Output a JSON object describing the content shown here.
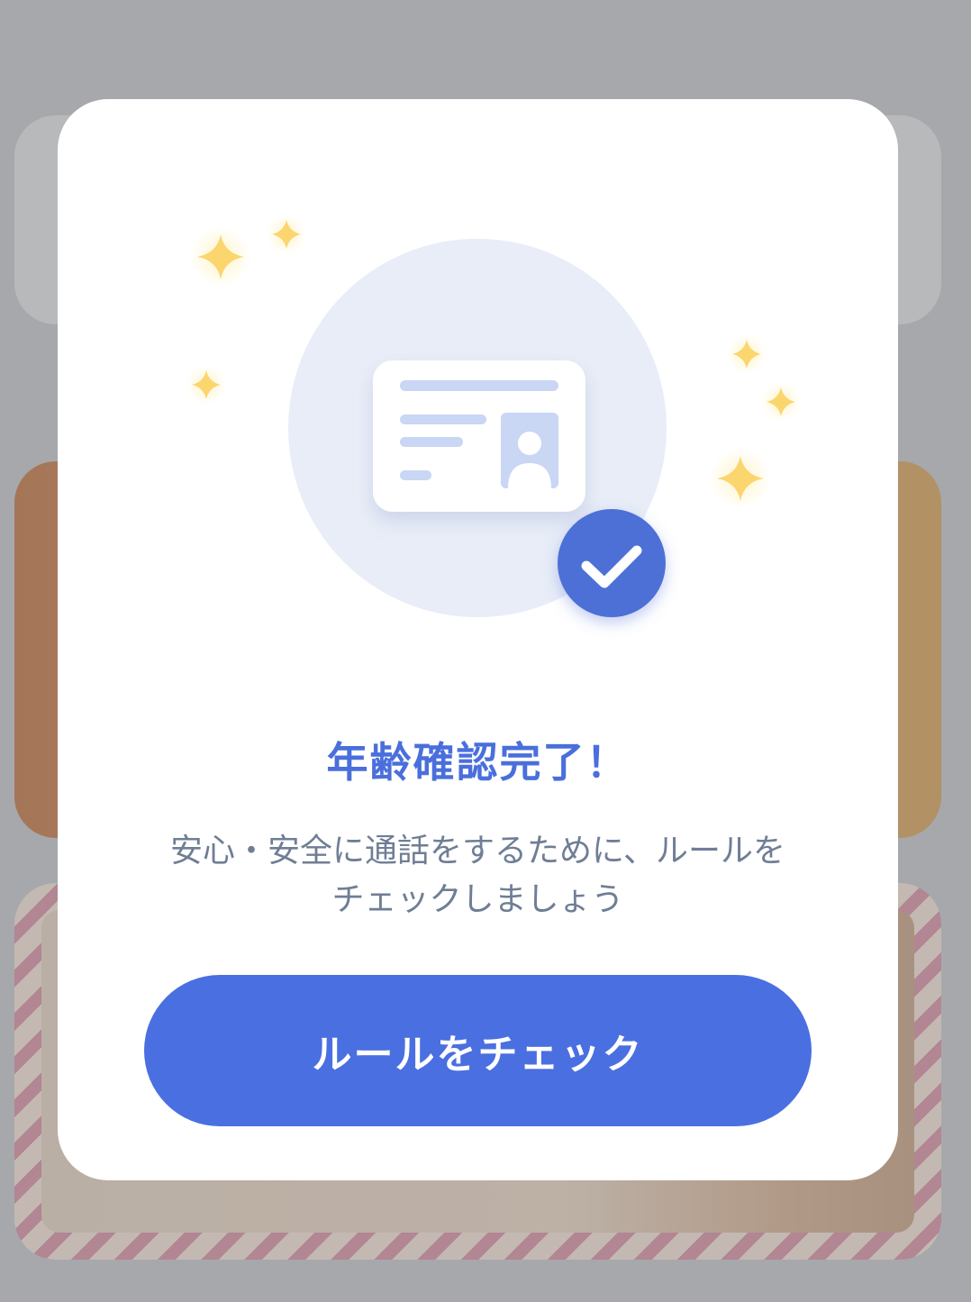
{
  "dialog": {
    "title": "年齢確認完了！",
    "message": "安心・安全に通話をするために、ルールをチェックしましょう",
    "button_label": "ルールをチェック"
  },
  "illustration": {
    "icons": [
      "id-card-icon",
      "verified-check-icon",
      "sparkle-icon"
    ]
  },
  "colors": {
    "accent": "#4a6fe0",
    "title": "#4a6fdc",
    "message": "#6f7e95",
    "sparkle": "#fbd66e",
    "badge": "#4e70d6",
    "circle": "#e8edf7"
  }
}
